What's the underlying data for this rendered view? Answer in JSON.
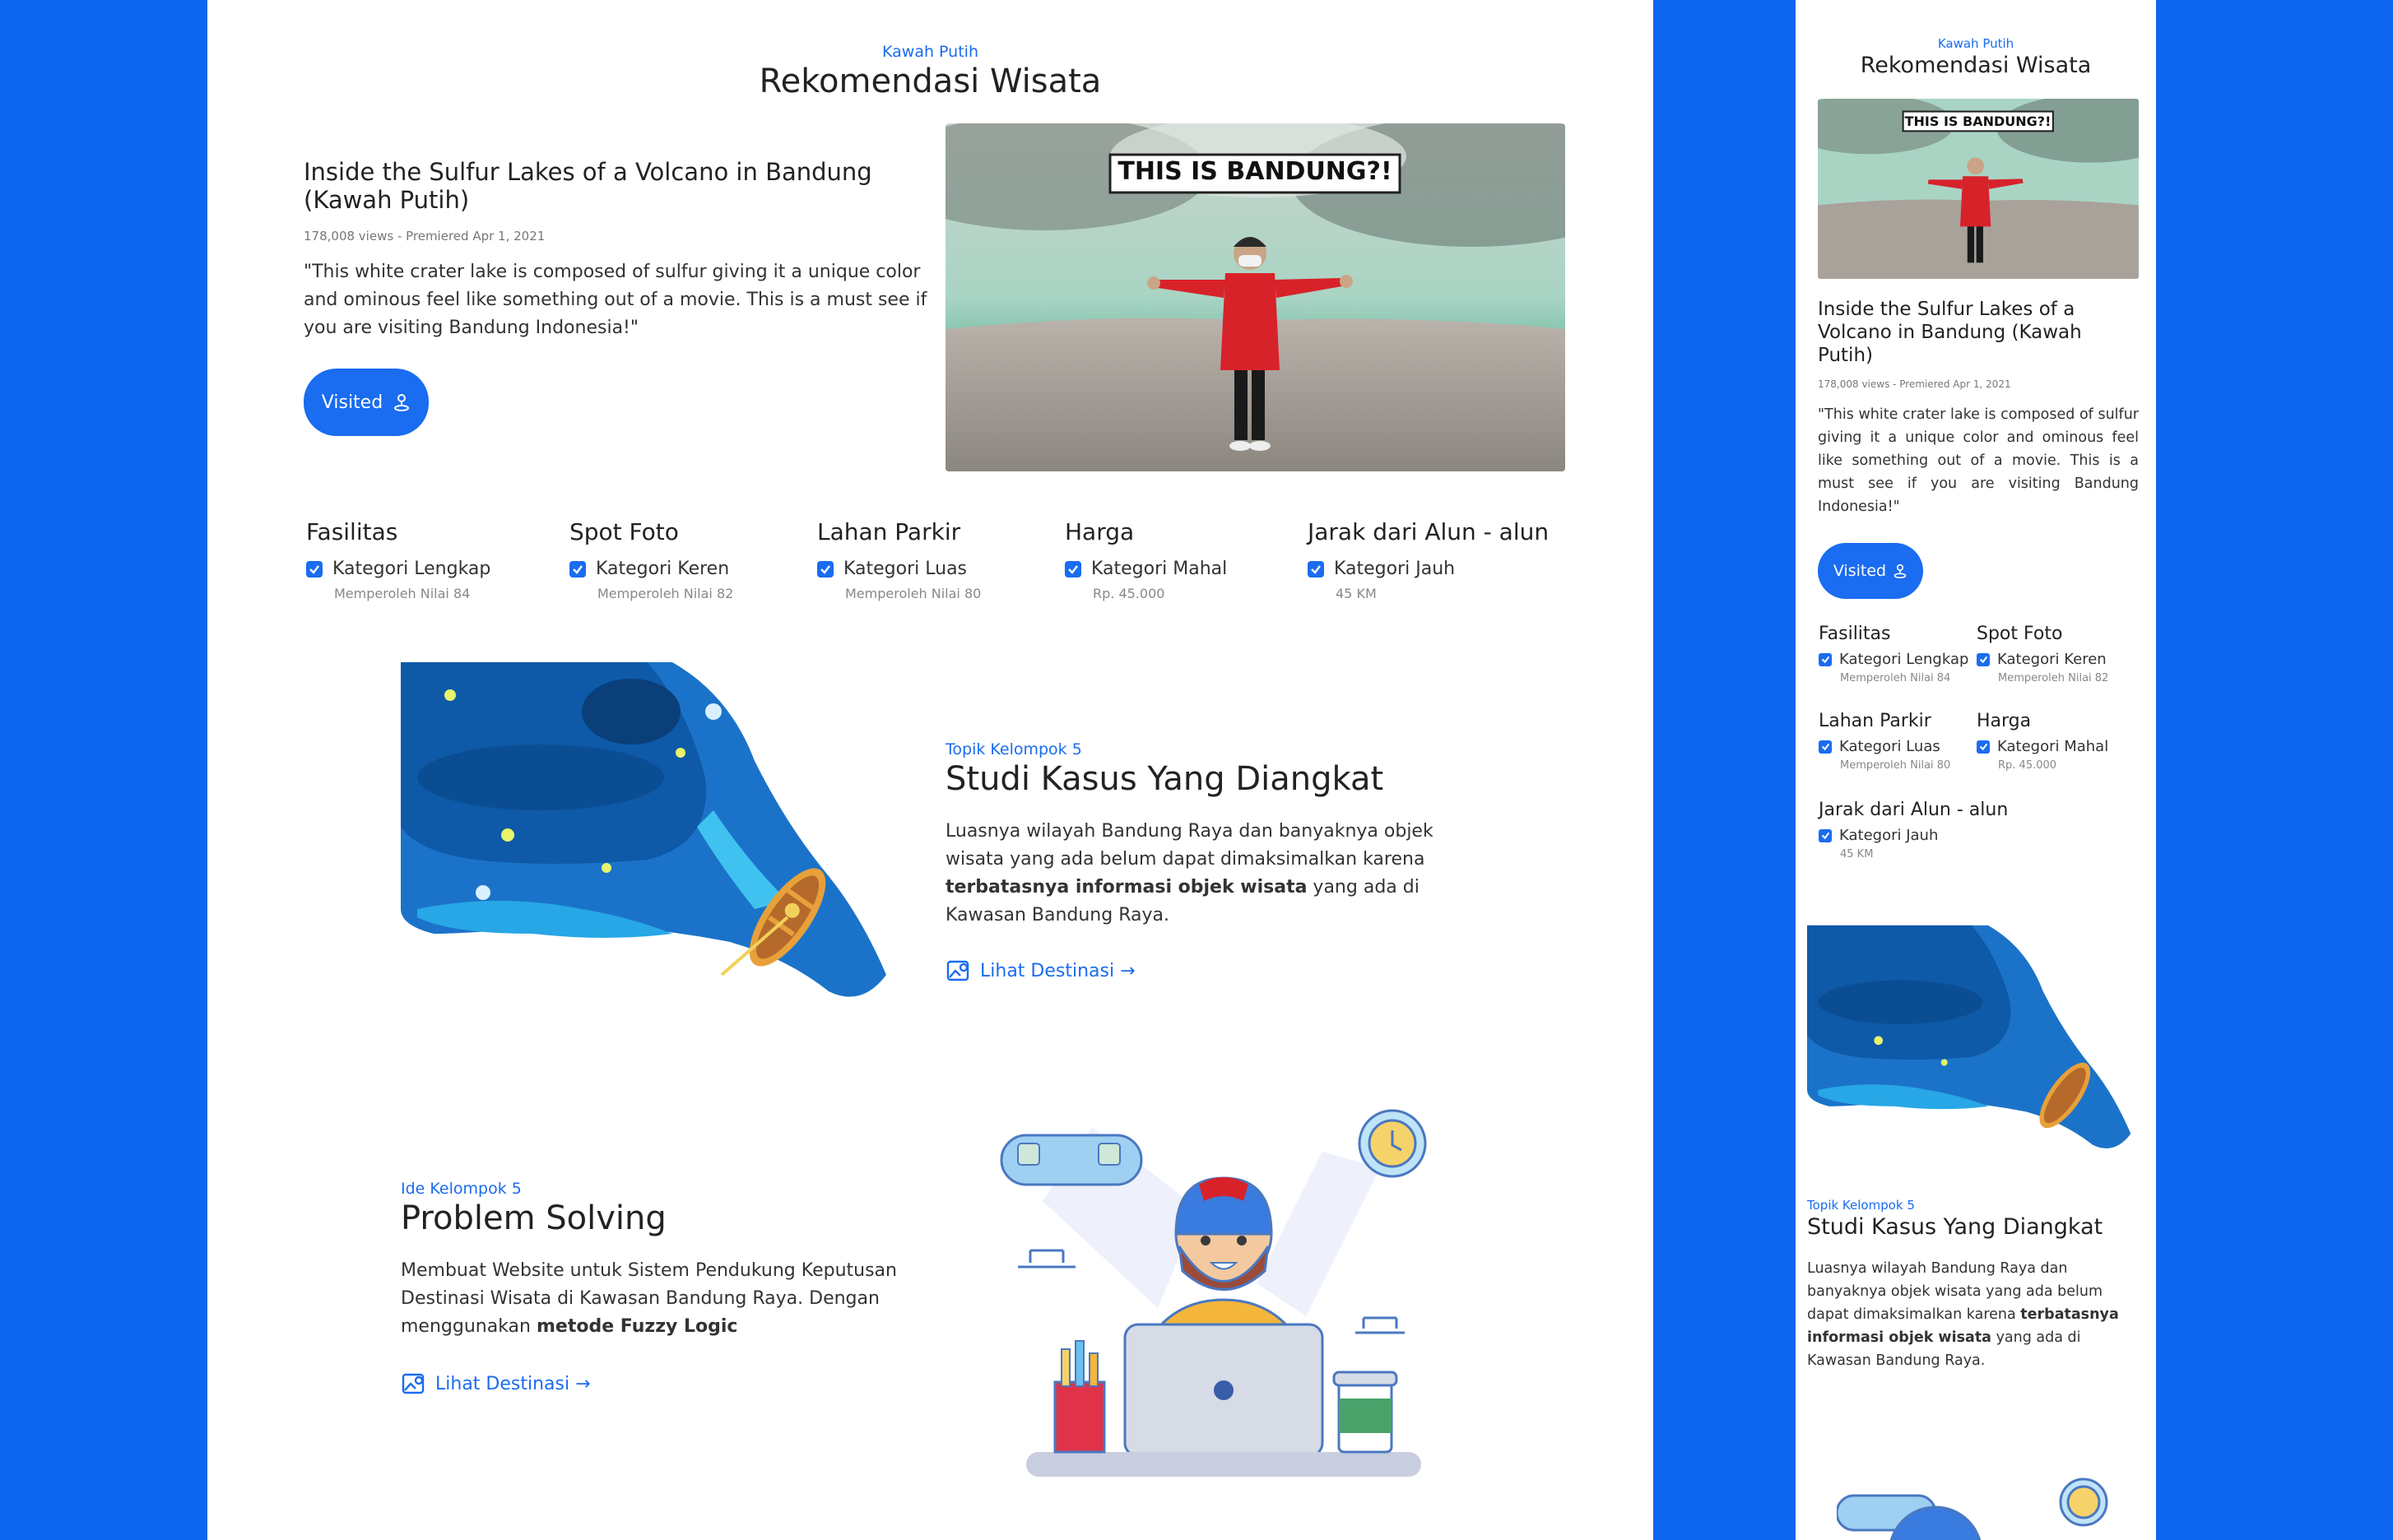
{
  "desktop": {
    "header": {
      "eyebrow": "Kawah Putih",
      "title": "Rekomendasi Wisata"
    },
    "video": {
      "title": "Inside the Sulfur Lakes of a Volcano in Bandung (Kawah Putih)",
      "meta": "178,008 views - Premiered Apr 1, 2021",
      "quote": "\"This white crater lake is composed of sulfur giving it a unique color and ominous feel like something out of a movie. This is a must see if you are visiting Bandung Indonesia!\"",
      "thumbnail_caption": "THIS IS BANDUNG?!",
      "button_label": "Visited",
      "button_icon": "person-pin-icon"
    },
    "criteria": [
      {
        "heading": "Fasilitas",
        "label": "Kategori Lengkap",
        "sub": "Memperoleh Nilai 84"
      },
      {
        "heading": "Spot Foto",
        "label": "Kategori Keren",
        "sub": "Memperoleh Nilai 82"
      },
      {
        "heading": "Lahan Parkir",
        "label": "Kategori Luas",
        "sub": "Memperoleh Nilai 80"
      },
      {
        "heading": "Harga",
        "label": "Kategori Mahal",
        "sub": "Rp. 45.000"
      },
      {
        "heading": "Jarak dari Alun - alun",
        "label": "Kategori Jauh",
        "sub": "45 KM"
      }
    ],
    "study": {
      "eyebrow": "Topik Kelompok 5",
      "title": "Studi Kasus Yang Diangkat",
      "text_before": "Luasnya wilayah Bandung Raya dan banyaknya objek wisata yang ada belum dapat dimaksimalkan karena ",
      "text_bold": "terbatasnya informasi objek wisata",
      "text_after": " yang ada di Kawasan Bandung Raya.",
      "link": "Lihat Destinasi →"
    },
    "problem": {
      "eyebrow": "Ide Kelompok 5",
      "title": "Problem Solving",
      "text_before": "Membuat Website untuk Sistem Pendukung Keputusan Destinasi Wisata di Kawasan Bandung Raya. Dengan menggunakan ",
      "text_bold": "metode Fuzzy Logic",
      "text_after": "",
      "link": "Lihat Destinasi →"
    }
  },
  "mobile": {
    "header": {
      "eyebrow": "Kawah Putih",
      "title": "Rekomendasi Wisata"
    },
    "video": {
      "title": "Inside the Sulfur Lakes of a Volcano in Bandung (Kawah Putih)",
      "meta": "178,008 views - Premiered Apr 1, 2021",
      "quote": "\"This white crater lake is composed of sulfur giving it a unique color and ominous feel like something out of a movie. This is a must see if you are visiting Bandung Indonesia!\"",
      "thumbnail_caption": "THIS IS BANDUNG?!",
      "button_label": "Visited"
    },
    "criteria": [
      {
        "heading": "Fasilitas",
        "label": "Kategori Lengkap",
        "sub": "Memperoleh Nilai 84"
      },
      {
        "heading": "Spot Foto",
        "label": "Kategori Keren",
        "sub": "Memperoleh Nilai 82"
      },
      {
        "heading": "Lahan Parkir",
        "label": "Kategori Luas",
        "sub": "Memperoleh Nilai 80"
      },
      {
        "heading": "Harga",
        "label": "Kategori Mahal",
        "sub": "Rp. 45.000"
      },
      {
        "heading": "Jarak dari Alun - alun",
        "label": "Kategori Jauh",
        "sub": "45 KM"
      }
    ],
    "study": {
      "eyebrow": "Topik Kelompok 5",
      "title": "Studi Kasus Yang Diangkat",
      "text_before": "Luasnya wilayah Bandung Raya dan banyaknya objek wisata yang ada belum dapat dimaksimalkan karena ",
      "text_bold": "terbatasnya informasi objek wisata",
      "text_after": " yang ada di Kawasan Bandung Raya."
    }
  },
  "colors": {
    "brand_blue": "#0e66f0",
    "accent": "#1a6cf0",
    "jacket_red": "#d8222a",
    "lake_mint": "#9fd1c0"
  }
}
